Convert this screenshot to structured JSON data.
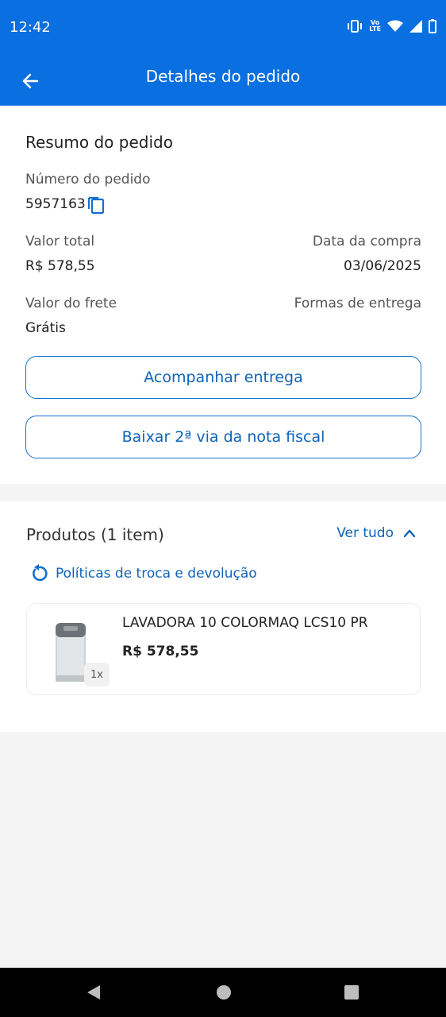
{
  "status_bar": {
    "time": "12:42",
    "lte_top": "Vo",
    "lte_bottom": "LTE",
    "icons": [
      "vibrate-icon",
      "volte-icon",
      "wifi-icon",
      "signal-icon",
      "battery-icon"
    ]
  },
  "app_bar": {
    "title": "Detalhes do pedido",
    "back_icon": "arrow-left-icon"
  },
  "summary": {
    "title": "Resumo do pedido",
    "order_number_label": "Número do pedido",
    "order_number": "5957163",
    "total_label": "Valor total",
    "total_value": "R$ 578,55",
    "purchase_date_label": "Data da compra",
    "purchase_date": "03/06/2025",
    "shipping_label": "Valor do frete",
    "shipping_value": "Grátis",
    "delivery_label": "Formas de entrega",
    "track_button": "Acompanhar entrega",
    "invoice_button": "Baixar 2ª via da nota fiscal"
  },
  "products": {
    "title": "Produtos (1 item)",
    "see_all": "Ver tudo",
    "policy_link": "Políticas de troca e devolução",
    "items": [
      {
        "name": "LAVADORA 10 COLORMAQ LCS10 PR",
        "price": "R$ 578,55",
        "quantity": "1x"
      }
    ]
  },
  "colors": {
    "primary": "#0a6fe0",
    "link": "#0f63b8",
    "background": "#f4f4f4"
  }
}
